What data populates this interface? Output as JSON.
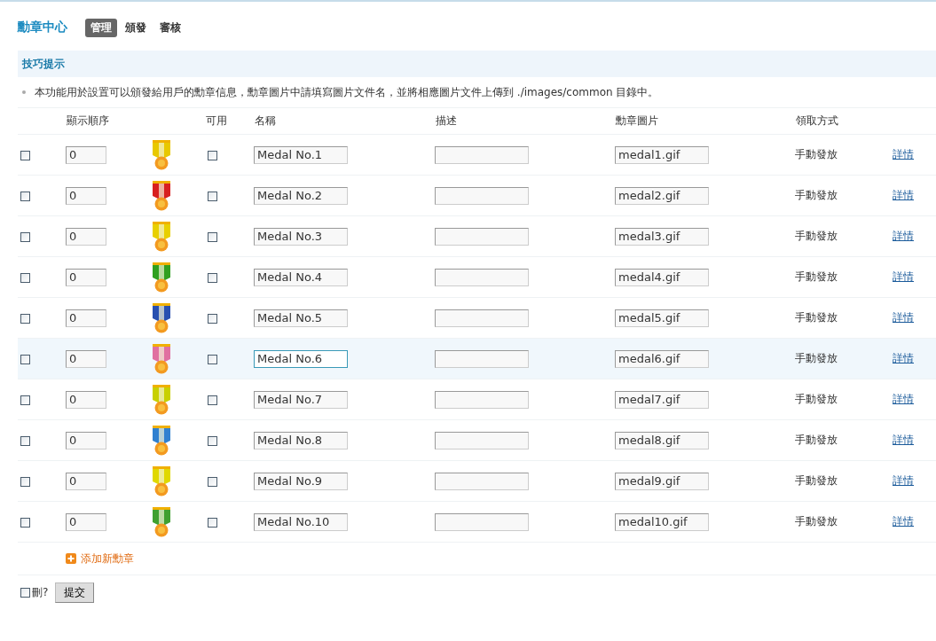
{
  "header": {
    "title": "勳章中心",
    "tabs": [
      {
        "label": "管理",
        "selected": true
      },
      {
        "label": "頒發",
        "selected": false
      },
      {
        "label": "審核",
        "selected": false
      }
    ]
  },
  "tips": {
    "title": "技巧提示",
    "items": [
      "本功能用於設置可以頒發給用戶的勳章信息，勳章圖片中請填寫圖片文件名，並將相應圖片文件上傳到 ./images/common 目錄中。"
    ]
  },
  "table": {
    "columns": [
      "顯示順序",
      "可用",
      "名稱",
      "描述",
      "勳章圖片",
      "領取方式"
    ],
    "rows": [
      {
        "selected": false,
        "order": "0",
        "color": "#e8c800",
        "enabled": false,
        "name": "Medal No.1",
        "image": "medal1.gif",
        "method": "手動發放",
        "detail": "詳情",
        "highlighted": false
      },
      {
        "selected": false,
        "order": "0",
        "color": "#d82020",
        "enabled": false,
        "name": "Medal No.2",
        "image": "medal2.gif",
        "method": "手動發放",
        "detail": "詳情",
        "highlighted": false
      },
      {
        "selected": false,
        "order": "0",
        "color": "#e8d000",
        "enabled": false,
        "name": "Medal No.3",
        "image": "medal3.gif",
        "method": "手動發放",
        "detail": "詳情",
        "highlighted": false
      },
      {
        "selected": false,
        "order": "0",
        "color": "#30a020",
        "enabled": false,
        "name": "Medal No.4",
        "image": "medal4.gif",
        "method": "手動發放",
        "detail": "詳情",
        "highlighted": false
      },
      {
        "selected": false,
        "order": "0",
        "color": "#2850b0",
        "enabled": false,
        "name": "Medal No.5",
        "image": "medal5.gif",
        "method": "手動發放",
        "detail": "詳情",
        "highlighted": false
      },
      {
        "selected": false,
        "order": "0",
        "color": "#e070a0",
        "enabled": false,
        "name": "Medal No.6",
        "image": "medal6.gif",
        "method": "手動發放",
        "detail": "詳情",
        "highlighted": true
      },
      {
        "selected": false,
        "order": "0",
        "color": "#c8d000",
        "enabled": false,
        "name": "Medal No.7",
        "image": "medal7.gif",
        "method": "手動發放",
        "detail": "詳情",
        "highlighted": false
      },
      {
        "selected": false,
        "order": "0",
        "color": "#3080d0",
        "enabled": false,
        "name": "Medal No.8",
        "image": "medal8.gif",
        "method": "手動發放",
        "detail": "詳情",
        "highlighted": false
      },
      {
        "selected": false,
        "order": "0",
        "color": "#e0d800",
        "enabled": false,
        "name": "Medal No.9",
        "image": "medal9.gif",
        "method": "手動發放",
        "detail": "詳情",
        "highlighted": false
      },
      {
        "selected": false,
        "order": "0",
        "color": "#40a030",
        "enabled": false,
        "name": "Medal No.10",
        "image": "medal10.gif",
        "method": "手動發放",
        "detail": "詳情",
        "highlighted": false
      }
    ]
  },
  "add_link": "添加新勳章",
  "footer": {
    "delete_label": "刪?",
    "delete_checked": false,
    "submit": "提交"
  }
}
